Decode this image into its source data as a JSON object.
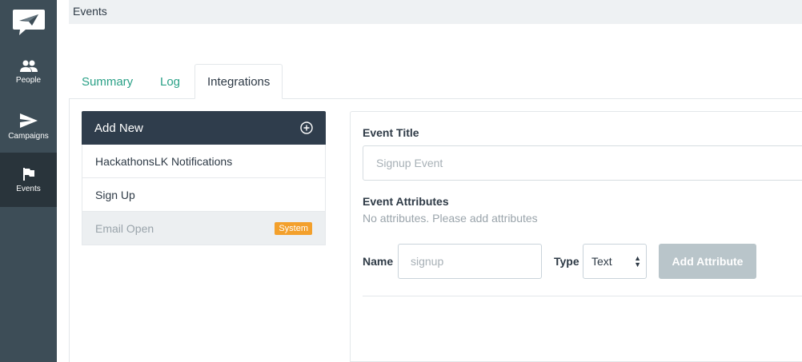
{
  "sidebar": {
    "logo_icon": "paper-plane-chat-icon",
    "items": [
      {
        "label": "People",
        "icon": "people-icon"
      },
      {
        "label": "Campaigns",
        "icon": "send-icon"
      },
      {
        "label": "Events",
        "icon": "flag-icon",
        "active": true
      }
    ]
  },
  "topbar": {
    "title": "Events"
  },
  "tabs": [
    {
      "label": "Summary"
    },
    {
      "label": "Log"
    },
    {
      "label": "Integrations",
      "active": true
    }
  ],
  "event_list": {
    "header_label": "Add New",
    "header_icon": "plus-circle-icon",
    "items": [
      {
        "label": "HackathonsLK Notifications"
      },
      {
        "label": "Sign Up"
      },
      {
        "label": "Email Open",
        "badge": "System",
        "selected": true
      }
    ]
  },
  "form": {
    "title_label": "Event Title",
    "title_placeholder": "Signup Event",
    "attributes_label": "Event Attributes",
    "attributes_helper": "No attributes. Please add attributes",
    "name_label": "Name",
    "name_placeholder": "signup",
    "type_label": "Type",
    "type_value": "Text",
    "add_button": "Add Attribute"
  },
  "colors": {
    "sidebar_bg": "#3d4d57",
    "sidebar_active": "#29343b",
    "accent_green": "#2aa187",
    "header_dark": "#2f3d4c",
    "badge_orange": "#f3a02c",
    "button_disabled": "#b9c5ca"
  }
}
